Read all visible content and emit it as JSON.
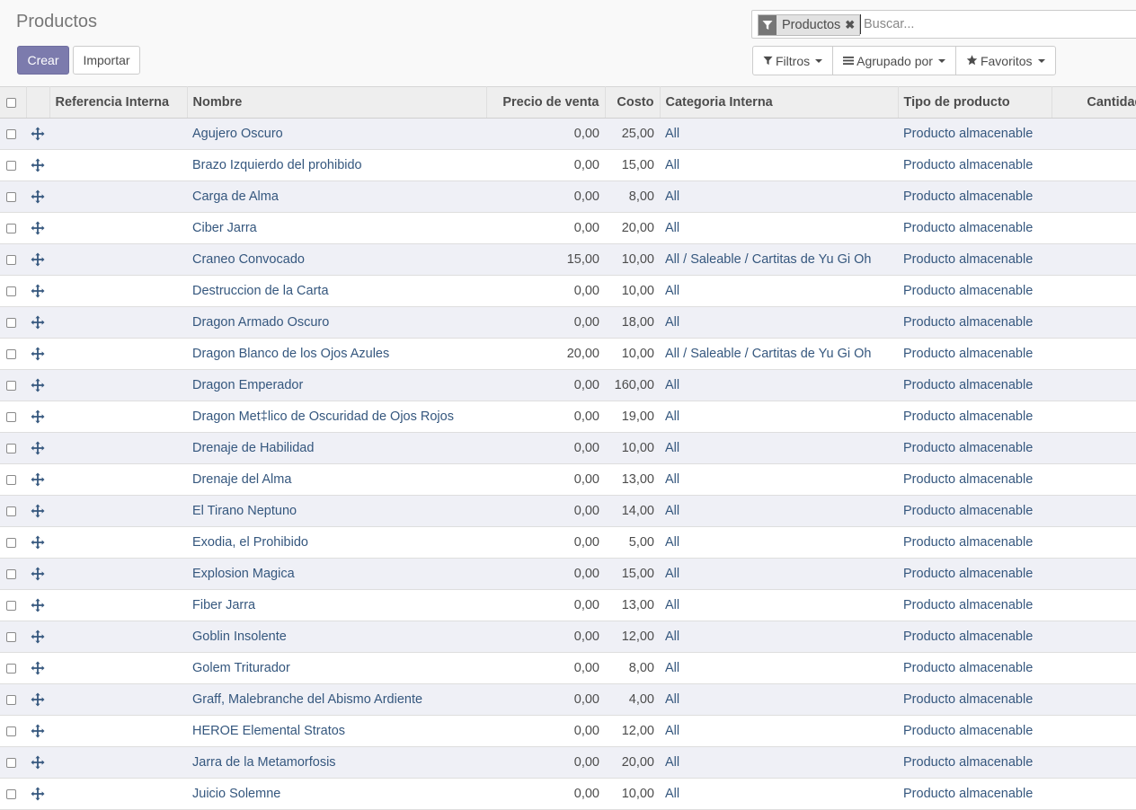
{
  "page": {
    "title": "Productos",
    "create_label": "Crear",
    "import_label": "Importar"
  },
  "search": {
    "facet_label": "Productos",
    "facet_icon": "filter-icon",
    "placeholder": "Buscar..."
  },
  "options": {
    "filters_label": "Filtros",
    "groupby_label": "Agrupado por",
    "favorites_label": "Favoritos"
  },
  "table": {
    "headers": {
      "ref": "Referencia Interna",
      "name": "Nombre",
      "price": "Precio de venta",
      "cost": "Costo",
      "category": "Categoria Interna",
      "type": "Tipo de producto",
      "qty": "Cantidad a"
    },
    "rows": [
      {
        "ref": "",
        "name": "Agujero Oscuro",
        "price": "0,00",
        "cost": "25,00",
        "category": "All",
        "type": "Producto almacenable"
      },
      {
        "ref": "",
        "name": "Brazo Izquierdo del prohibido",
        "price": "0,00",
        "cost": "15,00",
        "category": "All",
        "type": "Producto almacenable"
      },
      {
        "ref": "",
        "name": "Carga de Alma",
        "price": "0,00",
        "cost": "8,00",
        "category": "All",
        "type": "Producto almacenable"
      },
      {
        "ref": "",
        "name": "Ciber Jarra",
        "price": "0,00",
        "cost": "20,00",
        "category": "All",
        "type": "Producto almacenable"
      },
      {
        "ref": "",
        "name": "Craneo Convocado",
        "price": "15,00",
        "cost": "10,00",
        "category": "All / Saleable / Cartitas de Yu Gi Oh",
        "type": "Producto almacenable"
      },
      {
        "ref": "",
        "name": "Destruccion de la Carta",
        "price": "0,00",
        "cost": "10,00",
        "category": "All",
        "type": "Producto almacenable"
      },
      {
        "ref": "",
        "name": "Dragon Armado Oscuro",
        "price": "0,00",
        "cost": "18,00",
        "category": "All",
        "type": "Producto almacenable"
      },
      {
        "ref": "",
        "name": "Dragon Blanco de los Ojos Azules",
        "price": "20,00",
        "cost": "10,00",
        "category": "All / Saleable / Cartitas de Yu Gi Oh",
        "type": "Producto almacenable"
      },
      {
        "ref": "",
        "name": "Dragon Emperador",
        "price": "0,00",
        "cost": "160,00",
        "category": "All",
        "type": "Producto almacenable"
      },
      {
        "ref": "",
        "name": "Dragon Met‡lico de Oscuridad de Ojos Rojos",
        "price": "0,00",
        "cost": "19,00",
        "category": "All",
        "type": "Producto almacenable"
      },
      {
        "ref": "",
        "name": "Drenaje de Habilidad",
        "price": "0,00",
        "cost": "10,00",
        "category": "All",
        "type": "Producto almacenable"
      },
      {
        "ref": "",
        "name": "Drenaje del Alma",
        "price": "0,00",
        "cost": "13,00",
        "category": "All",
        "type": "Producto almacenable"
      },
      {
        "ref": "",
        "name": "El Tirano Neptuno",
        "price": "0,00",
        "cost": "14,00",
        "category": "All",
        "type": "Producto almacenable"
      },
      {
        "ref": "",
        "name": "Exodia, el Prohibido",
        "price": "0,00",
        "cost": "5,00",
        "category": "All",
        "type": "Producto almacenable"
      },
      {
        "ref": "",
        "name": "Explosion Magica",
        "price": "0,00",
        "cost": "15,00",
        "category": "All",
        "type": "Producto almacenable"
      },
      {
        "ref": "",
        "name": "Fiber Jarra",
        "price": "0,00",
        "cost": "13,00",
        "category": "All",
        "type": "Producto almacenable"
      },
      {
        "ref": "",
        "name": "Goblin Insolente",
        "price": "0,00",
        "cost": "12,00",
        "category": "All",
        "type": "Producto almacenable"
      },
      {
        "ref": "",
        "name": "Golem Triturador",
        "price": "0,00",
        "cost": "8,00",
        "category": "All",
        "type": "Producto almacenable"
      },
      {
        "ref": "",
        "name": "Graff, Malebranche del Abismo Ardiente",
        "price": "0,00",
        "cost": "4,00",
        "category": "All",
        "type": "Producto almacenable"
      },
      {
        "ref": "",
        "name": "HEROE Elemental Stratos",
        "price": "0,00",
        "cost": "12,00",
        "category": "All",
        "type": "Producto almacenable"
      },
      {
        "ref": "",
        "name": "Jarra de la Metamorfosis",
        "price": "0,00",
        "cost": "20,00",
        "category": "All",
        "type": "Producto almacenable"
      },
      {
        "ref": "",
        "name": "Juicio Solemne",
        "price": "0,00",
        "cost": "10,00",
        "category": "All",
        "type": "Producto almacenable"
      }
    ]
  },
  "colors": {
    "primary": "#7c7bad",
    "link": "#35577e",
    "odd_row": "#eff0f6"
  }
}
